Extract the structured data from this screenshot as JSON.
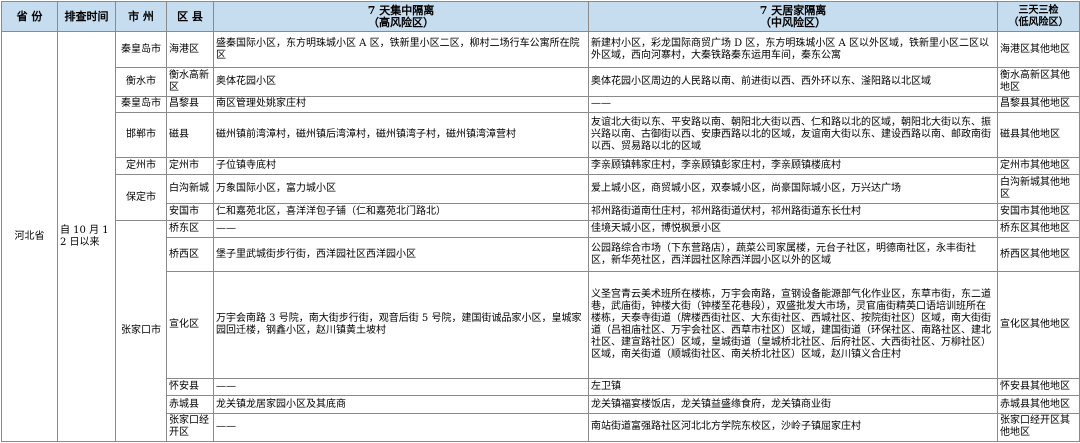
{
  "header": {
    "province": "省 份",
    "date": "排查时间",
    "city": "市 州",
    "county": "区 县",
    "high_title": "7 天集中隔离",
    "high_sub": "（高风险区）",
    "mid_title": "7 天居家隔离",
    "mid_sub": "（中风险区）",
    "low_title": "三天三检",
    "low_sub": "（低风险区）"
  },
  "province": "河北省",
  "date": "自 10 月 12 日以来",
  "rows": [
    {
      "city": "秦皇岛市",
      "county": "海港区",
      "high": "盛秦国际小区，东方明珠城小区 A 区，铁新里小区二区，柳村二场行车公寓所在院区",
      "mid": "新建村小区，彩龙国际商贸广场 D 区，东方明珠城小区 A 区以外区域，铁新里小区二区以外区域，西向河寨村，大秦铁路秦东运用车间，秦东公寓",
      "low": "海港区其他地区"
    },
    {
      "city": "衡水市",
      "county": "衡水高新区",
      "high": "奥体花园小区",
      "mid": "奥体花园小区周边的人民路以南、前进街以西、西外环以东、滏阳路以北区域",
      "low": "衡水高新区其他地区"
    },
    {
      "city": "秦皇岛市",
      "county": "昌黎县",
      "high": "南区管理处姚家庄村",
      "mid": "——",
      "low": "昌黎县其他地区"
    },
    {
      "city": "邯郸市",
      "county": "磁县",
      "high": "磁州镇前湾漳村，磁州镇后湾漳村，磁州镇湾子村，磁州镇湾漳营村",
      "mid": "友谊北大街以东、平安路以南、朝阳北大街以西、仁和路以北的区域，朝阳北大街以东、振兴路以南、古御街以西、安康西路以北的区域，友谊南大街以东、建设西路以南、邮政南街以西、贸易路以北的区域",
      "low": "磁县其他地区"
    },
    {
      "city": "定州市",
      "county": "定州市",
      "high": "子位镇寺底村",
      "mid": "李亲顾镇韩家庄村，李亲顾镇彭家庄村，李亲顾镇楼底村",
      "low": "定州市其他地区"
    },
    {
      "city": "保定市",
      "county": "白沟新城",
      "high": "万象国际小区，富力城小区",
      "mid": "爱上城小区，商贸城小区，双泰城小区，尚豪国际城小区，万兴达广场",
      "low": "白沟新城其他地区"
    },
    {
      "county": "安国市",
      "high": "仁和嘉苑北区，喜洋洋包子铺（仁和嘉苑北门路北）",
      "mid": "祁州路街道南仕庄村，祁州路街道伏村，祁州路街道东长仕村",
      "low": "安国市其他地区"
    },
    {
      "city": "张家口市",
      "county": "桥东区",
      "high": "——",
      "mid": "佳境天城小区，博悦枫景小区",
      "low": "桥东区其他地区"
    },
    {
      "county": "桥西区",
      "high": "堡子里武城街步行街，西洋园社区西洋园小区",
      "mid": "公园路综合市场（下东营路店），蔬菜公司家属楼，元台子社区，明德南社区，永丰街社区，新华苑社区，西洋园社区除西洋园小区以外的区域",
      "low": "桥西区其他地区"
    },
    {
      "county": "宣化区",
      "high": "万宇会南路 3 号院，南大街步行街，观音后街 5 号院，建国街诚品家小区，皇城家园回迁楼，钢鑫小区，赵川镇黄土坡村",
      "mid": "义圣宫青云美术班所在楼栋，万宇会南路，宣钢设备能源部气化作业区，东草市街，东二道巷，武庙街，钟楼大街（钟楼至花巷段），双盛批发大市场，灵官庙街精英口语培训班所在楼栋，天泰寺街道（牌楼西街社区、大东街社区、西城社区、按院街社区）区域，南大街街道（吕祖庙社区、万宇会社区、西草市社区）区域，建国街道（环保社区、南路社区、建北社区、建宣路社区）区域，皇城街道（皇城桥北社区、后府社区、大西街社区、万柳社区）区域，南关街道（顺城街社区、南关桥北社区）区域，赵川镇义合庄村",
      "low": "宣化区其他地区"
    },
    {
      "county": "怀安县",
      "high": "——",
      "mid": "左卫镇",
      "low": "怀安县其他地区"
    },
    {
      "county": "赤城县",
      "high": "龙关镇龙居家园小区及其底商",
      "mid": "龙关镇福宴楼饭店，龙关镇益盛缘食府，龙关镇商业街",
      "low": "赤城县其他地区"
    },
    {
      "county": "张家口经开区",
      "high": "——",
      "mid": "南站街道富强路社区河北北方学院东校区，沙岭子镇屈家庄村",
      "low": "张家口经开区其他地区"
    }
  ]
}
